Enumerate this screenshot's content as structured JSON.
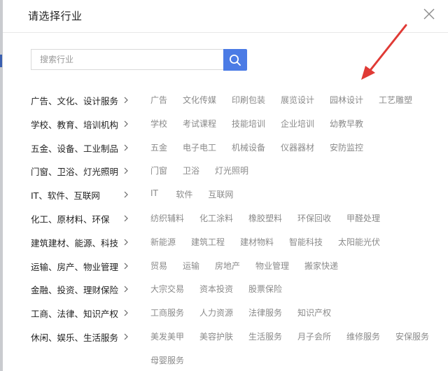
{
  "dialog": {
    "title": "请选择行业",
    "close_icon": "close-icon"
  },
  "search": {
    "placeholder": "搜索行业",
    "value": "",
    "icon": "search-icon",
    "accent": "#4b7be5"
  },
  "annotation": {
    "arrow_color": "#e03a35"
  },
  "categories": [
    {
      "label": "广告、文化、设计服务",
      "subs": [
        "广告",
        "文化传媒",
        "印刷包装",
        "展览设计",
        "园林设计",
        "工艺雕塑"
      ]
    },
    {
      "label": "学校、教育、培训机构",
      "subs": [
        "学校",
        "考试课程",
        "技能培训",
        "企业培训",
        "幼教早教"
      ]
    },
    {
      "label": "五金、设备、工业制品",
      "subs": [
        "五金",
        "电子电工",
        "机械设备",
        "仪器器材",
        "安防监控"
      ]
    },
    {
      "label": "门窗、卫浴、灯光照明",
      "subs": [
        "门窗",
        "卫浴",
        "灯光照明"
      ]
    },
    {
      "label": "IT、软件、互联网",
      "subs": [
        "IT",
        "软件",
        "互联网"
      ]
    },
    {
      "label": "化工、原材料、环保",
      "subs": [
        "纺织辅料",
        "化工涂料",
        "橡胶塑料",
        "环保回收",
        "甲醛处理"
      ]
    },
    {
      "label": "建筑建材、能源、科技",
      "subs": [
        "新能源",
        "建筑工程",
        "建材物料",
        "智能科技",
        "太阳能光伏"
      ]
    },
    {
      "label": "运输、房产、物业管理",
      "subs": [
        "贸易",
        "运输",
        "房地产",
        "物业管理",
        "搬家快递"
      ]
    },
    {
      "label": "金融、投资、理财保险",
      "subs": [
        "大宗交易",
        "资本投资",
        "股票保险"
      ]
    },
    {
      "label": "工商、法律、知识产权",
      "subs": [
        "工商服务",
        "人力资源",
        "法律服务",
        "知识产权"
      ]
    },
    {
      "label": "休闲、娱乐、生活服务",
      "subs": [
        "美发美甲",
        "美容护肤",
        "生活服务",
        "月子会所",
        "维修服务",
        "安保服务",
        "母婴服务"
      ]
    }
  ]
}
